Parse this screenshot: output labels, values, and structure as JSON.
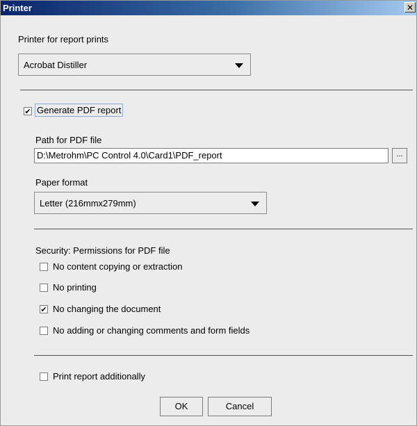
{
  "window": {
    "title": "Printer",
    "close_glyph": "✕"
  },
  "printer": {
    "label": "Printer for report prints",
    "selected": "Acrobat Distiller"
  },
  "pdf": {
    "generate_label": "Generate PDF report",
    "generate_checked": true,
    "path_label": "Path for PDF file",
    "path_value": "D:\\Metrohm\\PC Control 4.0\\Card1\\PDF_report",
    "browse_label": "...",
    "paper_label": "Paper format",
    "paper_selected": "Letter (216mmx279mm)"
  },
  "security": {
    "label": "Security: Permissions for PDF file",
    "options": [
      {
        "label": "No content copying or extraction",
        "checked": false
      },
      {
        "label": "No printing",
        "checked": false
      },
      {
        "label": "No changing the document",
        "checked": true
      },
      {
        "label": "No adding or changing comments and form fields",
        "checked": false
      }
    ]
  },
  "print_additionally": {
    "label": "Print report additionally",
    "checked": false
  },
  "buttons": {
    "ok": "OK",
    "cancel": "Cancel"
  }
}
